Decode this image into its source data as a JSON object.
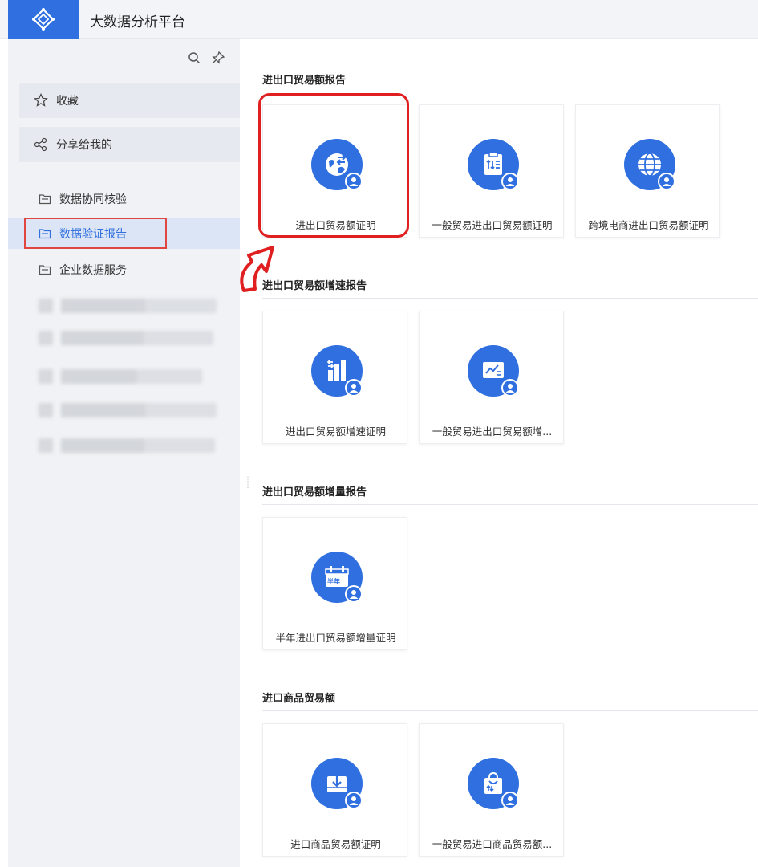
{
  "header": {
    "title": "大数据分析平台",
    "logo_icon": "diamond-nodes-logo-icon"
  },
  "sidebar": {
    "tools": [
      {
        "icon": "search-icon"
      },
      {
        "icon": "pin-icon"
      }
    ],
    "favorites": [
      {
        "label": "收藏",
        "icon": "star-icon"
      },
      {
        "label": "分享给我的",
        "icon": "share-icon"
      }
    ],
    "nav": [
      {
        "label": "数据协同核验",
        "icon": "folder-icon",
        "active": false
      },
      {
        "label": "数据验证报告",
        "icon": "folder-icon",
        "active": true
      },
      {
        "label": "企业数据服务",
        "icon": "folder-icon",
        "active": false
      }
    ]
  },
  "sections": [
    {
      "title": "进出口贸易额报告",
      "cards": [
        {
          "label": "进出口贸易额证明",
          "icon": "globe-transfer-icon"
        },
        {
          "label": "一般贸易进出口贸易额证明",
          "icon": "document-transfer-icon"
        },
        {
          "label": "跨境电商进出口贸易额证明",
          "icon": "globe-grid-icon"
        }
      ]
    },
    {
      "title": "进出口贸易额增速报告",
      "cards": [
        {
          "label": "进出口贸易额增速证明",
          "icon": "bar-growth-icon"
        },
        {
          "label": "一般贸易进出口贸易额增...",
          "icon": "trend-board-icon"
        }
      ]
    },
    {
      "title": "进出口贸易额增量报告",
      "cards": [
        {
          "label": "半年进出口贸易额增量证明",
          "icon": "calendar-half-year-icon"
        }
      ]
    },
    {
      "title": "进口商品贸易额",
      "cards": [
        {
          "label": "进口商品贸易额证明",
          "icon": "import-box-icon"
        },
        {
          "label": "一般贸易进口商品贸易额...",
          "icon": "shopping-bag-icon"
        }
      ]
    }
  ],
  "colors": {
    "accent": "#2f6fe0",
    "highlight_red": "#e02020",
    "sidebar_bg": "#f0f2f5"
  }
}
